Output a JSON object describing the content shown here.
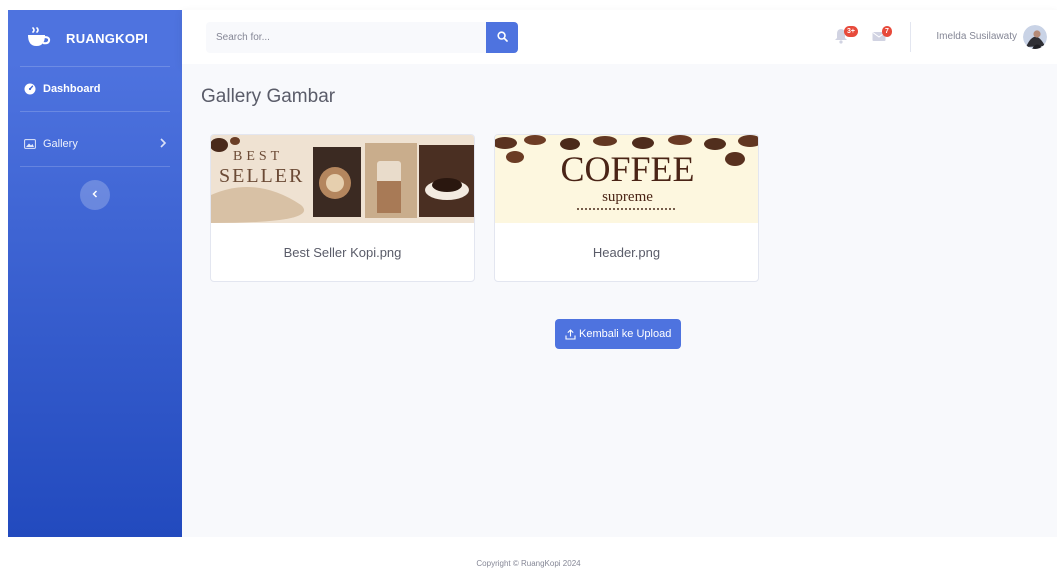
{
  "sidebar": {
    "brand": "RUANGKOPI",
    "items": [
      {
        "label": "Dashboard"
      },
      {
        "label": "Gallery"
      }
    ]
  },
  "topbar": {
    "search_placeholder": "Search for...",
    "alerts_badge": "3+",
    "messages_badge": "7",
    "user_name": "Imelda Susilawaty"
  },
  "page": {
    "title": "Gallery Gambar",
    "images": [
      {
        "name": "Best Seller Kopi.png",
        "thumb_line1": "BEST",
        "thumb_line2": "SELLER"
      },
      {
        "name": "Header.png",
        "thumb_line1": "COFFEE",
        "thumb_line2": "supreme"
      }
    ],
    "upload_button": "Kembali ke Upload"
  },
  "footer": {
    "copyright": "Copyright © RuangKopi 2024"
  },
  "colors": {
    "primary": "#4e73df",
    "sidebar_bottom": "#224abe",
    "badge": "#e74a3b",
    "background": "#f8f9fc"
  },
  "icons": [
    "coffee-cup-icon",
    "tachometer-icon",
    "image-icon",
    "chevron-right-icon",
    "chevron-left-icon",
    "search-icon",
    "bell-icon",
    "envelope-icon",
    "upload-icon"
  ]
}
